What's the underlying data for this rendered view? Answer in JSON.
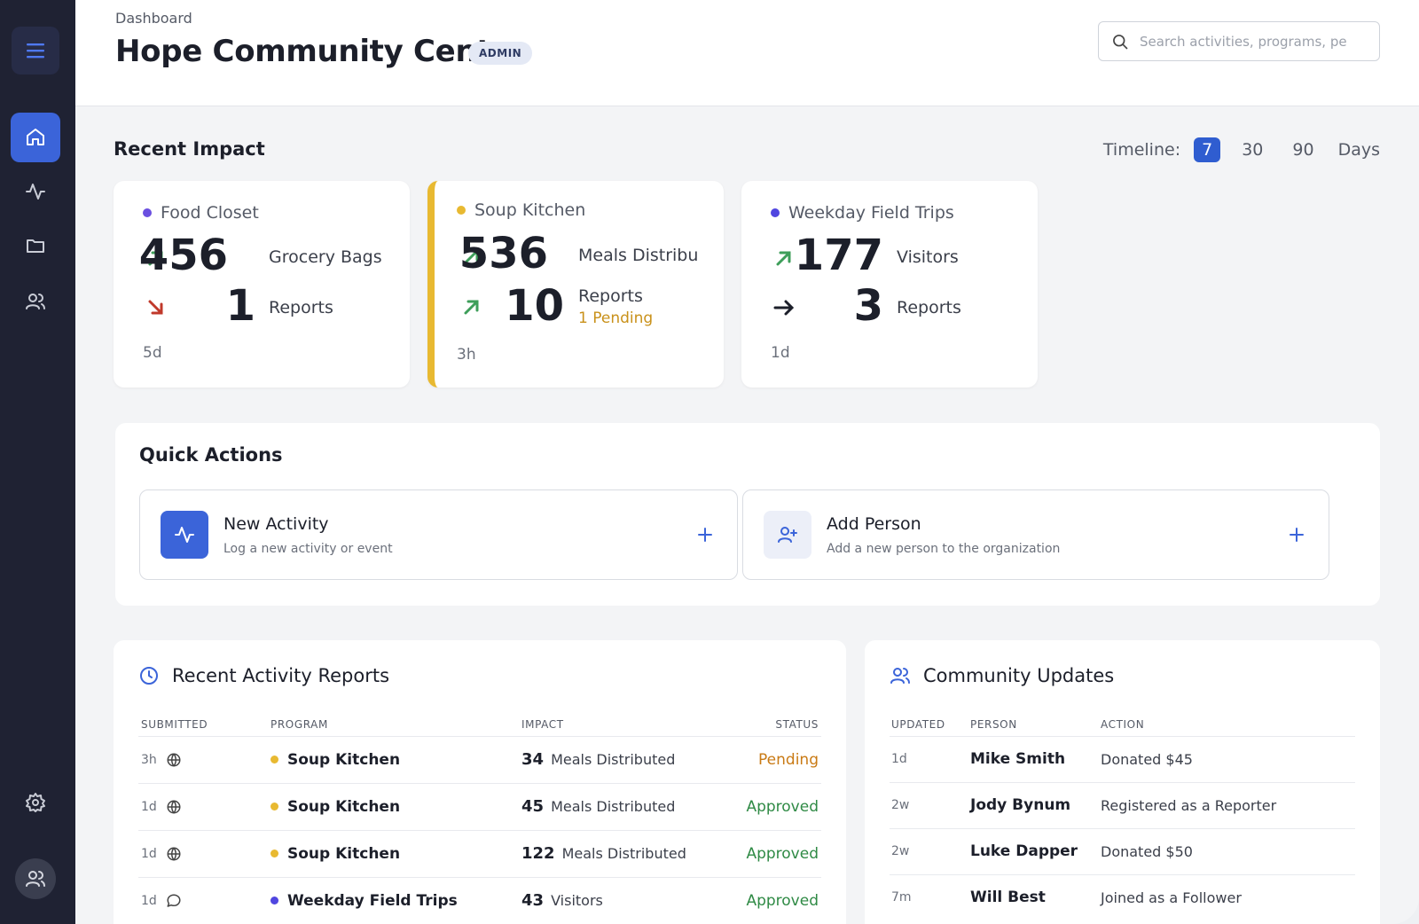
{
  "header": {
    "breadcrumb": "Dashboard",
    "title": "Hope Community Center",
    "role_badge": "ADMIN",
    "search_placeholder": "Search activities, programs, pe"
  },
  "sidebar": {
    "items": [
      {
        "name": "home",
        "icon": "home-icon",
        "active": true
      },
      {
        "name": "activity",
        "icon": "activity-pulse-icon",
        "active": false
      },
      {
        "name": "folder",
        "icon": "folder-icon",
        "active": false
      },
      {
        "name": "people",
        "icon": "users-icon",
        "active": false
      }
    ],
    "settings_icon": "gear-icon",
    "profile_icon": "user-avatar-icon"
  },
  "impact": {
    "title": "Recent Impact",
    "timeline_label": "Timeline:",
    "timeline_options": [
      "7",
      "30",
      "90"
    ],
    "timeline_selected": "7",
    "timeline_suffix": "Days",
    "cards": [
      {
        "program": "Food Closet",
        "dot_color": "#6a4fe0",
        "primary_value": "456",
        "primary_unit": "Grocery Bags",
        "primary_trend": "up",
        "secondary_value": "1",
        "secondary_unit": "Reports",
        "secondary_trend": "down",
        "pending": "",
        "age": "5d"
      },
      {
        "program": "Soup Kitchen",
        "dot_color": "#e8b931",
        "primary_value": "536",
        "primary_unit": "Meals Distribu...",
        "primary_trend": "up",
        "secondary_value": "10",
        "secondary_unit": "Reports",
        "secondary_trend": "up",
        "pending": "1 Pending",
        "age": "3h"
      },
      {
        "program": "Weekday Field Trips",
        "dot_color": "#5046e0",
        "primary_value": "177",
        "primary_unit": "Visitors",
        "primary_trend": "up",
        "secondary_value": "3",
        "secondary_unit": "Reports",
        "secondary_trend": "flat",
        "pending": "",
        "age": "1d"
      }
    ]
  },
  "quick_actions": {
    "title": "Quick Actions",
    "items": [
      {
        "title": "New Activity",
        "subtitle": "Log a new activity or event",
        "icon": "activity-pulse-icon"
      },
      {
        "title": "Add Person",
        "subtitle": "Add a new person to the organization",
        "icon": "user-plus-icon"
      }
    ]
  },
  "activity_reports": {
    "title": "Recent Activity Reports",
    "columns": [
      "SUBMITTED",
      "PROGRAM",
      "IMPACT",
      "STATUS"
    ],
    "rows": [
      {
        "submitted": "3h",
        "source_icon": "globe-icon",
        "program": "Soup Kitchen",
        "program_color": "#e8b931",
        "impact_value": "34",
        "impact_unit": "Meals Distributed",
        "status": "Pending"
      },
      {
        "submitted": "1d",
        "source_icon": "globe-icon",
        "program": "Soup Kitchen",
        "program_color": "#e8b931",
        "impact_value": "45",
        "impact_unit": "Meals Distributed",
        "status": "Approved"
      },
      {
        "submitted": "1d",
        "source_icon": "globe-icon",
        "program": "Soup Kitchen",
        "program_color": "#e8b931",
        "impact_value": "122",
        "impact_unit": "Meals Distributed",
        "status": "Approved"
      },
      {
        "submitted": "1d",
        "source_icon": "chat-bubble-icon",
        "program": "Weekday Field Trips",
        "program_color": "#5046e0",
        "impact_value": "43",
        "impact_unit": "Visitors",
        "status": "Approved"
      }
    ]
  },
  "community_updates": {
    "title": "Community Updates",
    "columns": [
      "UPDATED",
      "PERSON",
      "ACTION"
    ],
    "rows": [
      {
        "updated": "1d",
        "person": "Mike Smith",
        "action": "Donated $45"
      },
      {
        "updated": "2w",
        "person": "Jody Bynum",
        "action": "Registered as a Reporter"
      },
      {
        "updated": "2w",
        "person": "Luke Dapper",
        "action": "Donated $50"
      },
      {
        "updated": "7m",
        "person": "Will Best",
        "action": "Joined as a Follower"
      }
    ]
  },
  "colors": {
    "sidebar_bg": "#1f2233",
    "accent_blue": "#3b64d9",
    "trend_up": "#3e9e5a",
    "trend_down": "#c0392b",
    "pending": "#c97a14",
    "approved": "#2f8a45"
  }
}
